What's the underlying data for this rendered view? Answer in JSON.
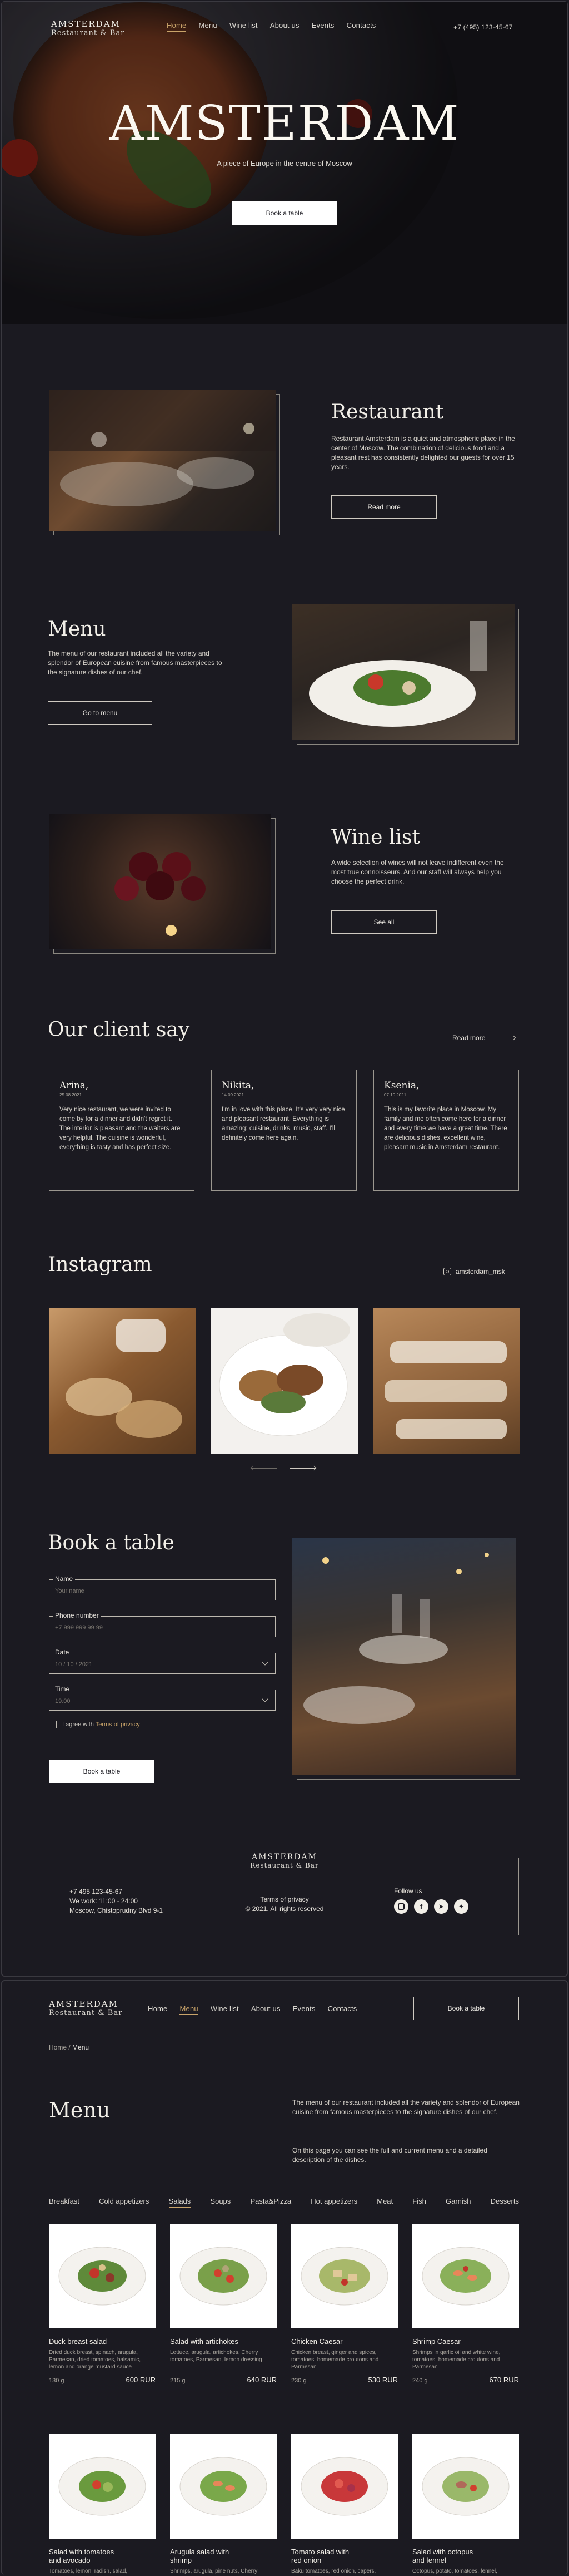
{
  "home": {
    "logo": {
      "title": "AMSTERDAM",
      "subtitle": "Restaurant & Bar"
    },
    "nav": [
      {
        "label": "Home",
        "active": true
      },
      {
        "label": "Menu",
        "active": false
      },
      {
        "label": "Wine list",
        "active": false
      },
      {
        "label": "About us",
        "active": false
      },
      {
        "label": "Events",
        "active": false
      },
      {
        "label": "Contacts",
        "active": false
      }
    ],
    "phone": "+7 (495) 123-45-67",
    "hero": {
      "title": "AMSTERDAM",
      "tagline": "A piece of Europe in the centre of Moscow",
      "cta": "Book a table"
    },
    "restaurant": {
      "title": "Restaurant",
      "text": "Restaurant Amsterdam is a quiet and atmospheric place in the center of Moscow. The combination of delicious food and a pleasant rest has consistently delighted our guests for over 15 years.",
      "button": "Read more"
    },
    "menu_section": {
      "title": "Menu",
      "text": "The menu of our restaurant included all the variety and splendor of European cuisine from famous masterpieces to the signature dishes of our chef.",
      "button": "Go to menu"
    },
    "wine": {
      "title": "Wine list",
      "text": "A wide selection of wines will not leave indifferent even the most true connoisseurs. And our staff will always help you choose the perfect drink.",
      "button": "See all"
    },
    "reviews": {
      "title": "Our client say",
      "more": "Read more",
      "items": [
        {
          "name": "Arina,",
          "date": "25.08.2021",
          "text": "Very nice restaurant, we were invited to come by for a dinner and didn't regret it. The interior is pleasant and the waiters are very helpful. The cuisine is wonderful, everything is tasty and has perfect size."
        },
        {
          "name": "Nikita,",
          "date": "14.09.2021",
          "text": "I'm in love with this place. It's very very nice and pleasant restaurant. Everything is amazing: cuisine, drinks, music, staff. I'll definitely come here again."
        },
        {
          "name": "Ksenia,",
          "date": "07.10.2021",
          "text": "This is my favorite place in Moscow. My family and me often come here for a dinner and every time we have a great time. There are delicious dishes, excellent wine, pleasant music in Amsterdam restaurant."
        }
      ]
    },
    "instagram": {
      "title": "Instagram",
      "handle": "amsterdam_msk"
    },
    "booking": {
      "title": "Book a table",
      "fields": [
        {
          "label": "Name",
          "placeholder": "Your name"
        },
        {
          "label": "Phone number",
          "placeholder": "+7 999 999 99 99"
        },
        {
          "label": "Date",
          "placeholder": "10 / 10 / 2021"
        },
        {
          "label": "Time",
          "placeholder": "19:00"
        }
      ],
      "privacy_prefix": "I agree with ",
      "privacy_link": "Terms of privacy",
      "button": "Book a table"
    },
    "footer": {
      "phone": "+7 495 123-45-67",
      "hours": "We work: 11:00 - 24:00",
      "address": "Moscow, Chistoprudny Blvd 9-1",
      "terms": "Terms of privacy",
      "copyright": "© 2021. All rights reserved",
      "follow": "Follow us"
    }
  },
  "menu_page": {
    "nav_button": "Book a table",
    "breadcrumb": {
      "home": "Home",
      "sep": " / ",
      "current": "Menu"
    },
    "title": "Menu",
    "intro1": "The menu of our restaurant included all the variety and splendor of European cuisine from famous masterpieces to the signature dishes of our chef.",
    "intro2": "On this page you can see the full and current menu and a detailed description of the dishes.",
    "tabs": [
      "Breakfast",
      "Cold appetizers",
      "Salads",
      "Soups",
      "Pasta&Pizza",
      "Hot appetizers",
      "Meat",
      "Fish",
      "Garnish",
      "Desserts"
    ],
    "active_tab": 2,
    "dishes": [
      {
        "name": "Duck breast salad",
        "desc": "Dried duck breast, spinach, arugula, Parmesan, dried tomatoes, balsamic, lemon and orange mustard sauce",
        "weight": "130 g",
        "price": "600 RUR"
      },
      {
        "name": "Salad with artichokes",
        "desc": "Lettuce, arugula, artichokes, Cherry tomatoes, Parmesan, lemon dressing",
        "weight": "215 g",
        "price": "640 RUR"
      },
      {
        "name": "Chicken Caesar",
        "desc": "Chicken breast, ginger and spices, tomatoes, homemade croutons and Parmesan",
        "weight": "230 g",
        "price": "530 RUR"
      },
      {
        "name": "Shrimp Caesar",
        "desc": "Shrimps in garlic oil and white wine, tomatoes, homemade croutons and Parmesan",
        "weight": "240 g",
        "price": "670 RUR"
      },
      {
        "name": "Salad with tomatoes and avocado",
        "desc": "Tomatoes, lemon, radish, salad,",
        "weight": "",
        "price": ""
      },
      {
        "name": "Arugula salad with shrimp",
        "desc": "Shrimps, arugula, pine nuts, Cherry",
        "weight": "",
        "price": ""
      },
      {
        "name": "Tomato salad with red onion",
        "desc": "Baku tomatoes, red onion, capers,",
        "weight": "",
        "price": ""
      },
      {
        "name": "Salad with octopus and fennel",
        "desc": "Octopus, potato, tomatoes, fennel,",
        "weight": "",
        "price": ""
      }
    ]
  }
}
